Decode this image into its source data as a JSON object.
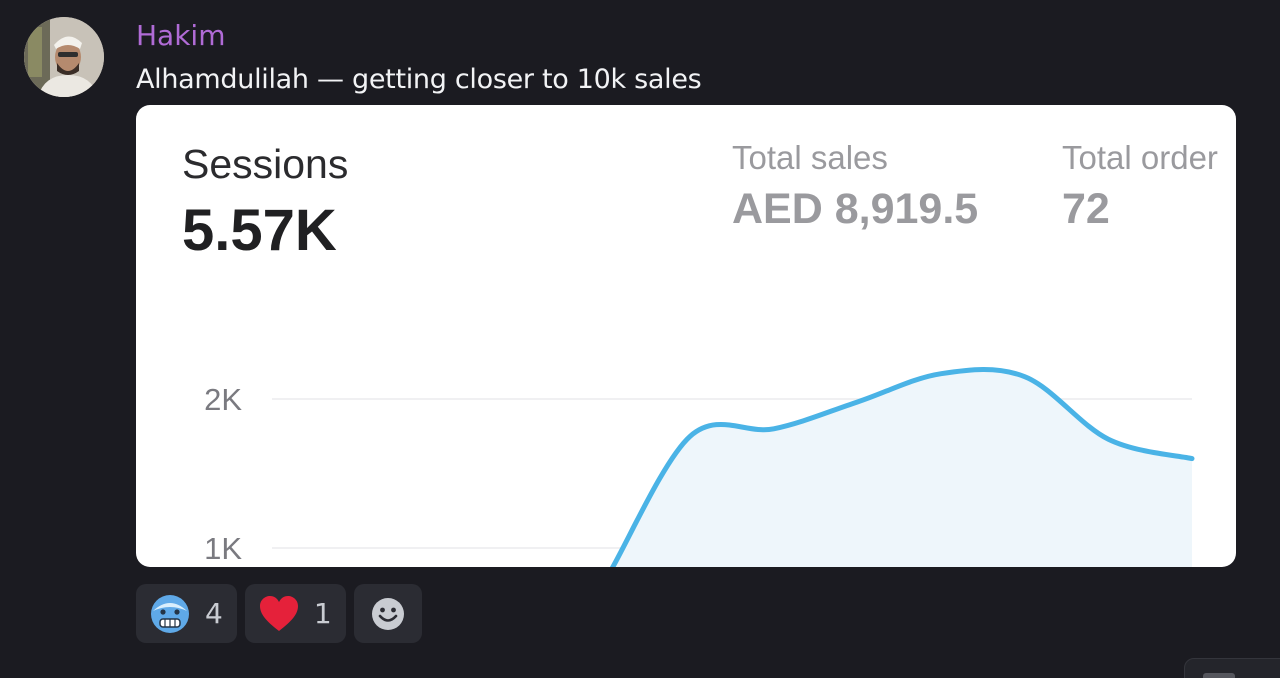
{
  "author": {
    "name": "Hakim",
    "color": "#b06bd6"
  },
  "message": {
    "text": "Alhamdulilah — getting closer to 10k sales"
  },
  "embed": {
    "sessions_label": "Sessions",
    "sessions_value": "5.57K",
    "total_sales_label": "Total sales",
    "total_sales_value": "AED 8,919.5",
    "total_orders_label": "Total order",
    "total_orders_value": "72",
    "chart_data": {
      "type": "area",
      "y_ticks": [
        "2K",
        "1K"
      ],
      "y_tick_values": [
        2000,
        1000
      ],
      "ylim": [
        700,
        2300
      ],
      "line_color": "#4ab3e6",
      "fill_color": "#eef6fb",
      "grid": true,
      "x": [
        0,
        1,
        2,
        3,
        4,
        5,
        6,
        7,
        8,
        9,
        10,
        11
      ],
      "values": [
        null,
        null,
        null,
        null,
        800,
        1750,
        1800,
        1980,
        2170,
        2150,
        1730,
        1600
      ]
    }
  },
  "reactions": [
    {
      "emoji": "cold-face-emoji",
      "count": "4"
    },
    {
      "emoji": "red-heart-emoji",
      "count": "1"
    }
  ],
  "add_reaction": {
    "icon": "smiley-add-reaction-icon"
  }
}
